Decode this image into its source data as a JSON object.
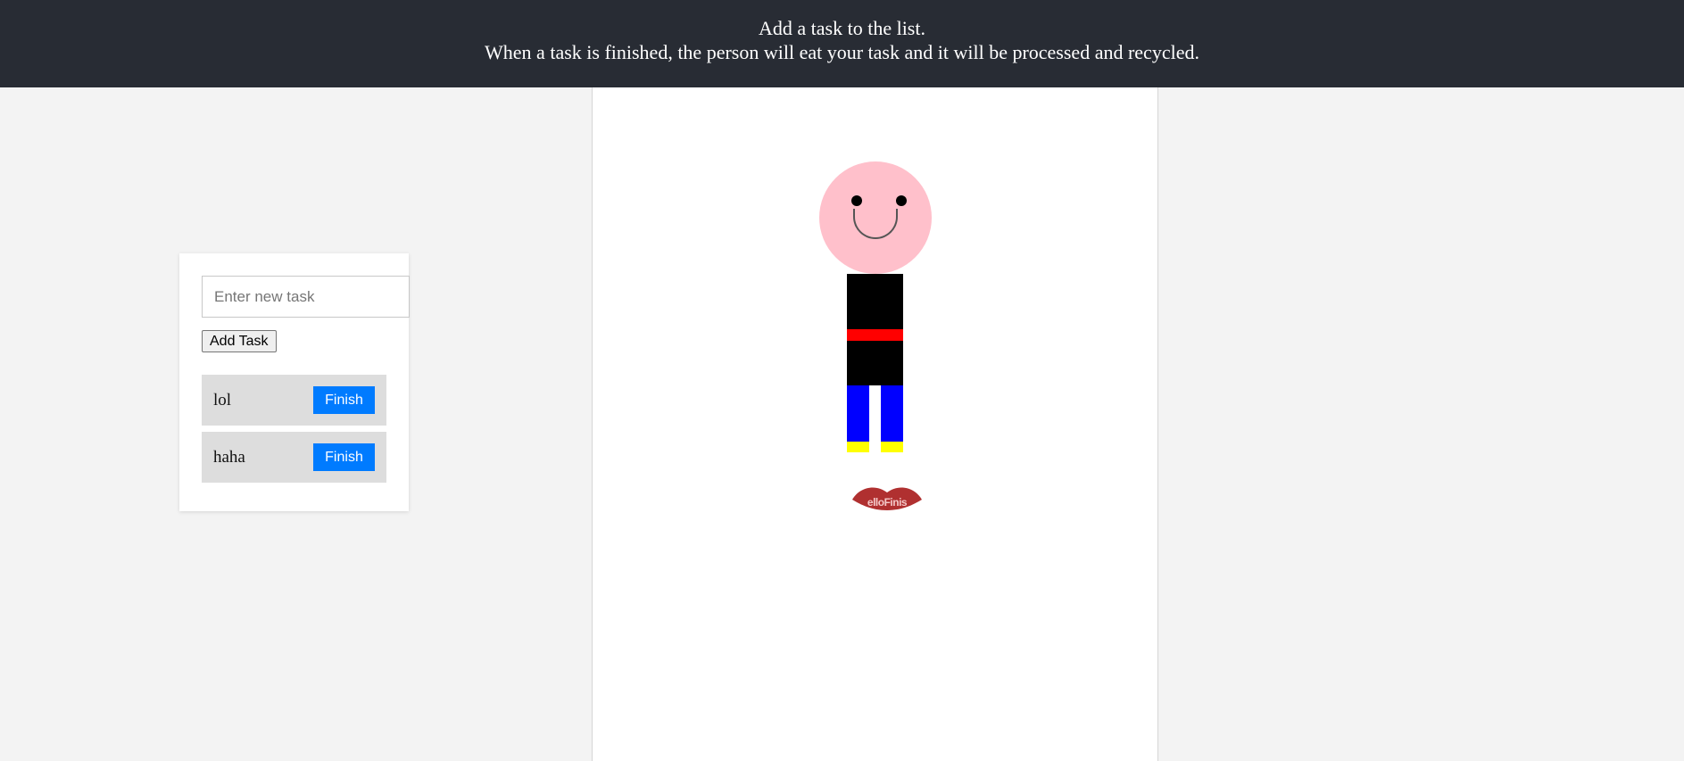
{
  "header": {
    "line1": "Add a task to the list.",
    "line2": "When a task is finished, the person will eat your task and it will be processed and recycled."
  },
  "todo": {
    "input_placeholder": "Enter new task",
    "input_value": "",
    "add_button_label": "Add Task",
    "tasks": [
      {
        "text": "lol",
        "finish_label": "Finish"
      },
      {
        "text": "haha",
        "finish_label": "Finish"
      }
    ]
  },
  "lips": {
    "text": "elloFinis"
  },
  "colors": {
    "header_bg": "#282c34",
    "finish_button": "#007bff",
    "head": "#ffc0cb",
    "torso": "#000000",
    "belt": "#ff0000",
    "legs": "#0000ff",
    "shoes": "#ffff00",
    "lips": "#b03030"
  }
}
